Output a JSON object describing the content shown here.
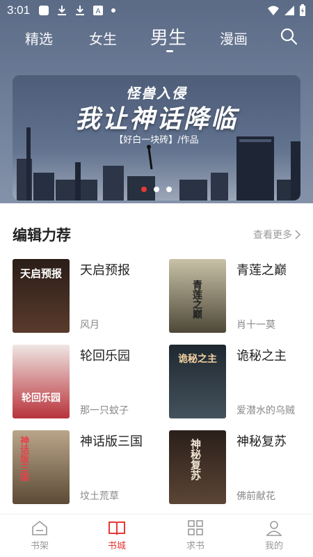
{
  "status_bar": {
    "time": "3:01",
    "icons": [
      "app-icon",
      "download-icon",
      "download-icon",
      "font-icon",
      "dot-icon"
    ],
    "right_icons": [
      "wifi-icon",
      "signal-icon",
      "battery-charging-icon"
    ]
  },
  "tabs": [
    {
      "label": "精选",
      "active": false
    },
    {
      "label": "女生",
      "active": false
    },
    {
      "label": "男生",
      "active": true
    },
    {
      "label": "漫画",
      "active": false
    }
  ],
  "banner": {
    "subtitle": "怪兽入侵",
    "title": "我让神话降临",
    "author": "【好白一块砖】/作品",
    "dots": 3,
    "active_dot": 0
  },
  "section": {
    "title": "编辑力荐",
    "more": "查看更多"
  },
  "books": [
    {
      "title": "天启预报",
      "author": "风月",
      "cover_text": "天启预报",
      "cover_color": "#3d2a20"
    },
    {
      "title": "青莲之巅",
      "author": "肖十一莫",
      "cover_text": "青莲之巅",
      "cover_color": "#6a6450"
    },
    {
      "title": "轮回乐园",
      "author": "那一只蚊子",
      "cover_text": "轮回乐园",
      "cover_color": "#c7a9a2"
    },
    {
      "title": "诡秘之主",
      "author": "爱潜水的乌贼",
      "cover_text": "诡秘之主",
      "cover_color": "#2d3a44"
    },
    {
      "title": "神话版三国",
      "author": "坟土荒草",
      "cover_text": "神话版三国",
      "cover_color": "#8c7a62"
    },
    {
      "title": "神秘复苏",
      "author": "佛前献花",
      "cover_text": "神秘复苏",
      "cover_color": "#3a2a22"
    }
  ],
  "bottom_nav": [
    {
      "label": "书架",
      "icon": "bookshelf-icon",
      "active": false
    },
    {
      "label": "书城",
      "icon": "open-book-icon",
      "active": true
    },
    {
      "label": "求书",
      "icon": "grid-icon",
      "active": false
    },
    {
      "label": "我的",
      "icon": "person-icon",
      "active": false
    }
  ],
  "colors": {
    "accent": "#e53935",
    "header_bg": "#6b7b96"
  }
}
